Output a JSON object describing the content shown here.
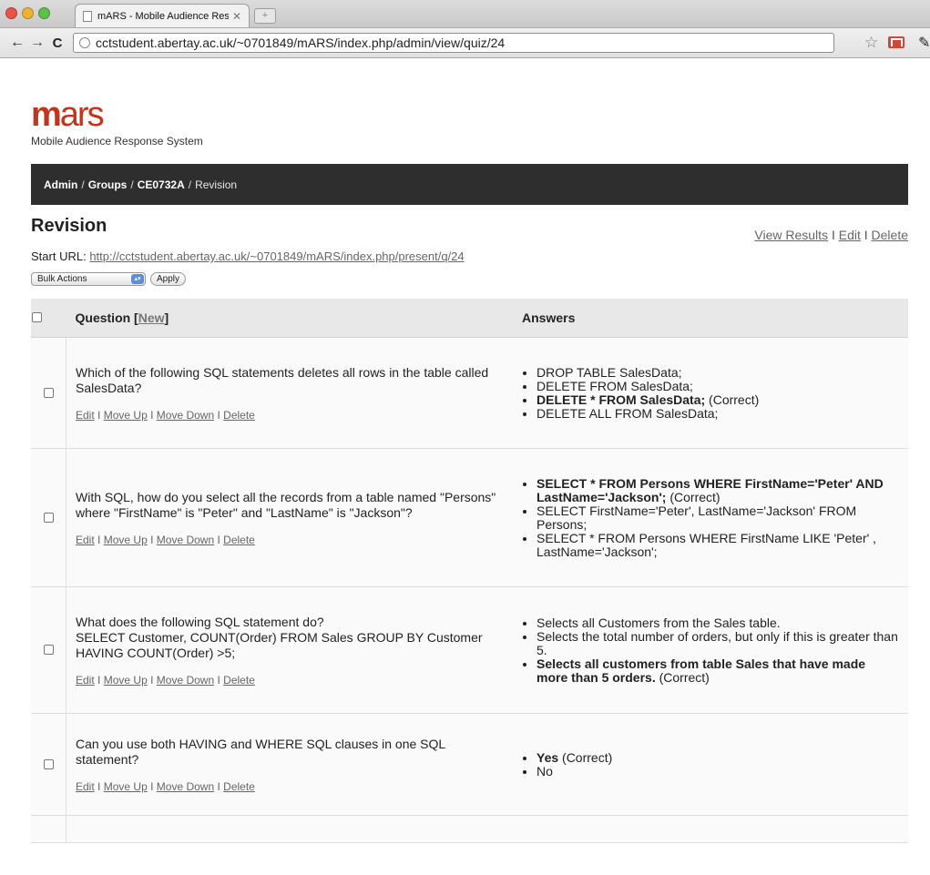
{
  "browser": {
    "tab_title": "mARS - Mobile Audience Res",
    "tab_close": "✕",
    "new_tab": "+",
    "url": "cctstudent.abertay.ac.uk/~0701849/mARS/index.php/admin/view/quiz/24"
  },
  "brand": {
    "logo_bold": "m",
    "logo_rest": "ars",
    "tagline": "Mobile Audience Response System"
  },
  "breadcrumb": {
    "admin": "Admin",
    "groups": "Groups",
    "group": "CE0732A",
    "current": "Revision",
    "sep": "/"
  },
  "page": {
    "title": "Revision",
    "actions": {
      "view_results": "View Results",
      "edit": "Edit",
      "delete": "Delete",
      "sep": "I"
    },
    "start_url_label": "Start URL:",
    "start_url": "http://cctstudent.abertay.ac.uk/~0701849/mARS/index.php/present/q/24"
  },
  "bulk": {
    "select_value": "Bulk Actions",
    "apply_label": "Apply"
  },
  "table": {
    "col_question": "Question",
    "col_question_new": "New",
    "col_answers": "Answers",
    "row_actions": {
      "edit": "Edit",
      "move_up": "Move Up",
      "move_down": "Move Down",
      "delete": "Delete",
      "sep": "I"
    },
    "rows": [
      {
        "question": "Which of the following SQL statements deletes all rows in the table called SalesData?",
        "answers": [
          {
            "text": "DROP TABLE SalesData;",
            "correct": false
          },
          {
            "text": "DELETE FROM SalesData;",
            "correct": false
          },
          {
            "text": "DELETE * FROM SalesData;",
            "correct": true
          },
          {
            "text": "DELETE ALL FROM SalesData;",
            "correct": false
          }
        ]
      },
      {
        "question": "With SQL, how do you select all the records from a table named \"Persons\" where \"FirstName\" is \"Peter\" and \"LastName\" is \"Jackson\"?",
        "answers": [
          {
            "text": "SELECT * FROM Persons WHERE FirstName='Peter' AND LastName='Jackson';",
            "correct": true
          },
          {
            "text": "SELECT FirstName='Peter', LastName='Jackson' FROM Persons;",
            "correct": false
          },
          {
            "text": "SELECT * FROM Persons WHERE FirstName LIKE 'Peter' , LastName='Jackson';",
            "correct": false
          }
        ]
      },
      {
        "question": "What does the following SQL statement do?\nSELECT Customer, COUNT(Order) FROM Sales GROUP BY Customer HAVING COUNT(Order) >5;",
        "answers": [
          {
            "text": "Selects all Customers from the Sales table.",
            "correct": false
          },
          {
            "text": "Selects the total number of orders, but only if this is greater than 5.",
            "correct": false
          },
          {
            "text": "Selects all customers from table Sales that have made more than 5 orders.",
            "correct": true
          }
        ]
      },
      {
        "question": "Can you use both HAVING and WHERE SQL clauses in one SQL statement?",
        "answers": [
          {
            "text": "Yes",
            "correct": true
          },
          {
            "text": "No",
            "correct": false
          }
        ]
      }
    ],
    "correct_marker": "(Correct)"
  },
  "colors": {
    "brand": "#c0351b",
    "crumb_bg": "#2e2e2e",
    "header_bg": "#e8e8e8"
  }
}
